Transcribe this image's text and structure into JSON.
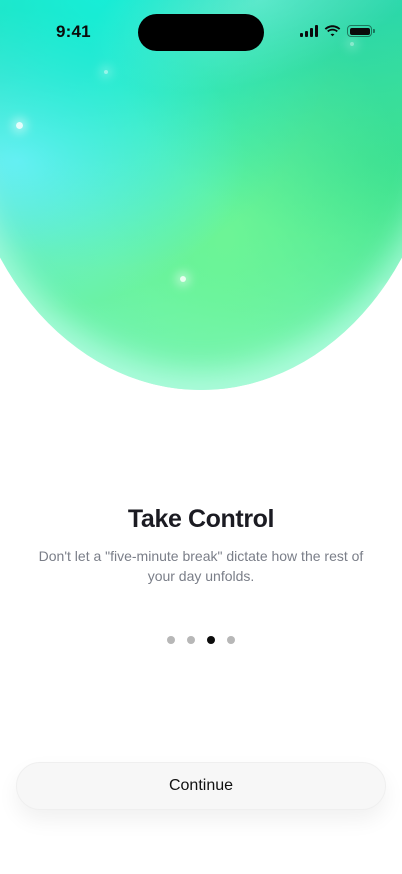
{
  "status_bar": {
    "time": "9:41",
    "icons": [
      "cellular-signal-icon",
      "wifi-icon",
      "battery-icon"
    ]
  },
  "onboarding": {
    "title": "Take Control",
    "subtitle": "Don't let a \"five-minute break\" dictate how the rest of your day unfolds.",
    "page_indicator": {
      "total": 4,
      "current_index": 2
    },
    "continue_label": "Continue"
  },
  "colors": {
    "gradient_primary": "#22e8cf",
    "gradient_green": "#5af09a",
    "gradient_cyan": "#8ff5d6",
    "title_text": "#1b1b22",
    "subtitle_text": "#7a7e88",
    "dot_inactive": "#b7b7b7",
    "dot_active": "#0b0b0b",
    "button_bg": "#f7f7f7"
  }
}
